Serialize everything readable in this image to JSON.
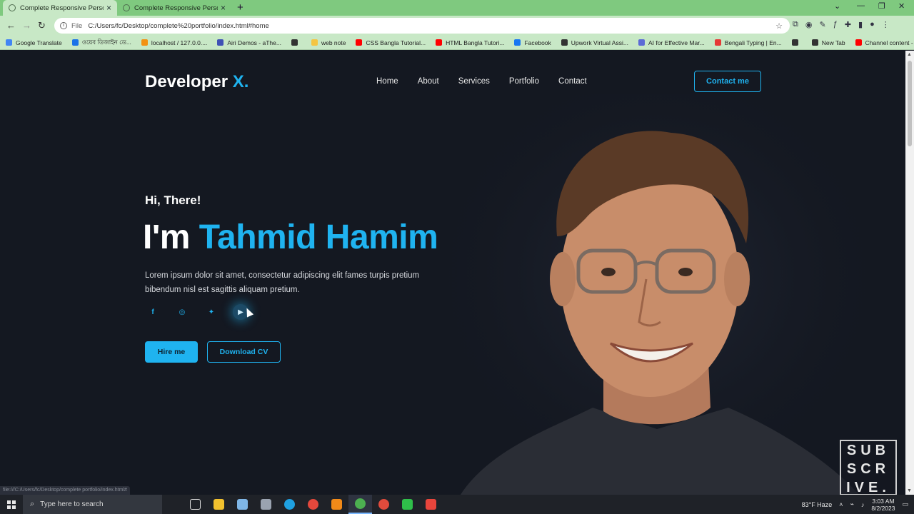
{
  "browser": {
    "tabs": [
      {
        "title": "Complete Responsive Personal P",
        "active": true
      },
      {
        "title": "Complete Responsive Personal P",
        "active": false
      }
    ],
    "url_prefix": "File",
    "url": "C:/Users/fc/Desktop/complete%20portfolio/index.html#home",
    "status_url": "file:///C:/Users/fc/Desktop/complete portfolio/index.html#",
    "bookmarks": [
      {
        "label": "Google Translate",
        "color": "#4285f4"
      },
      {
        "label": "ওয়েব ডিজাইন ডে...",
        "color": "#1a73e8"
      },
      {
        "label": "localhost / 127.0.0....",
        "color": "#f29111"
      },
      {
        "label": "Airi Demos - aThe...",
        "color": "#3f51b5"
      },
      {
        "label": "",
        "color": "#333333"
      },
      {
        "label": "web note",
        "color": "#f4c542"
      },
      {
        "label": "CSS Bangla Tutorial...",
        "color": "#ff0000"
      },
      {
        "label": "HTML Bangla Tutori...",
        "color": "#ff0000"
      },
      {
        "label": "Facebook",
        "color": "#1877f2"
      },
      {
        "label": "Upwork Virtual Assi...",
        "color": "#333333"
      },
      {
        "label": "AI for Effective Mar...",
        "color": "#5b6bd6"
      },
      {
        "label": "Bengali Typing | En...",
        "color": "#e53935"
      },
      {
        "label": "",
        "color": "#333333"
      },
      {
        "label": "New Tab",
        "color": "#333333"
      },
      {
        "label": "Channel content - Y...",
        "color": "#ff0000"
      }
    ]
  },
  "site": {
    "logo_text": "Developer",
    "logo_accent": "X.",
    "nav": [
      "Home",
      "About",
      "Services",
      "Portfolio",
      "Contact"
    ],
    "contact_button": "Contact me",
    "greeting": "Hi, There!",
    "heading_prefix": "I'm",
    "heading_name": "Tahmid Hamim",
    "description": "Lorem ipsum dolor sit amet, consectetur adipiscing elit fames turpis pretium bibendum nisl est sagittis aliquam pretium.",
    "socials": [
      {
        "name": "facebook-icon",
        "glyph": "f"
      },
      {
        "name": "instagram-icon",
        "glyph": "◎"
      },
      {
        "name": "twitter-icon",
        "glyph": "✦"
      },
      {
        "name": "youtube-icon",
        "glyph": "▶"
      }
    ],
    "hire_button": "Hire me",
    "cv_button": "Download CV",
    "accent_color": "#1fb3f0"
  },
  "overlay": {
    "subscribe_lines": [
      "SUB",
      "SCR",
      "IVE."
    ]
  },
  "taskbar": {
    "search_placeholder": "Type here to search",
    "weather": "83°F  Haze",
    "time": "3:03 AM",
    "date": "8/2/2023"
  }
}
